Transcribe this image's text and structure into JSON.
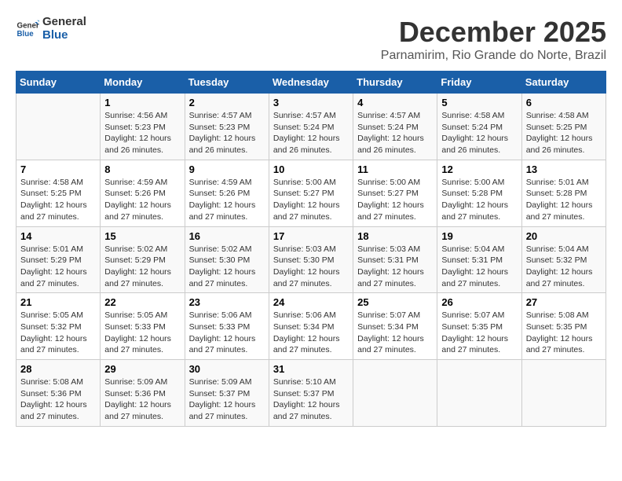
{
  "logo": {
    "line1": "General",
    "line2": "Blue"
  },
  "title": "December 2025",
  "subtitle": "Parnamirim, Rio Grande do Norte, Brazil",
  "days_of_week": [
    "Sunday",
    "Monday",
    "Tuesday",
    "Wednesday",
    "Thursday",
    "Friday",
    "Saturday"
  ],
  "weeks": [
    [
      {
        "day": "",
        "info": ""
      },
      {
        "day": "1",
        "info": "Sunrise: 4:56 AM\nSunset: 5:23 PM\nDaylight: 12 hours\nand 26 minutes."
      },
      {
        "day": "2",
        "info": "Sunrise: 4:57 AM\nSunset: 5:23 PM\nDaylight: 12 hours\nand 26 minutes."
      },
      {
        "day": "3",
        "info": "Sunrise: 4:57 AM\nSunset: 5:24 PM\nDaylight: 12 hours\nand 26 minutes."
      },
      {
        "day": "4",
        "info": "Sunrise: 4:57 AM\nSunset: 5:24 PM\nDaylight: 12 hours\nand 26 minutes."
      },
      {
        "day": "5",
        "info": "Sunrise: 4:58 AM\nSunset: 5:24 PM\nDaylight: 12 hours\nand 26 minutes."
      },
      {
        "day": "6",
        "info": "Sunrise: 4:58 AM\nSunset: 5:25 PM\nDaylight: 12 hours\nand 26 minutes."
      }
    ],
    [
      {
        "day": "7",
        "info": "Sunrise: 4:58 AM\nSunset: 5:25 PM\nDaylight: 12 hours\nand 27 minutes."
      },
      {
        "day": "8",
        "info": "Sunrise: 4:59 AM\nSunset: 5:26 PM\nDaylight: 12 hours\nand 27 minutes."
      },
      {
        "day": "9",
        "info": "Sunrise: 4:59 AM\nSunset: 5:26 PM\nDaylight: 12 hours\nand 27 minutes."
      },
      {
        "day": "10",
        "info": "Sunrise: 5:00 AM\nSunset: 5:27 PM\nDaylight: 12 hours\nand 27 minutes."
      },
      {
        "day": "11",
        "info": "Sunrise: 5:00 AM\nSunset: 5:27 PM\nDaylight: 12 hours\nand 27 minutes."
      },
      {
        "day": "12",
        "info": "Sunrise: 5:00 AM\nSunset: 5:28 PM\nDaylight: 12 hours\nand 27 minutes."
      },
      {
        "day": "13",
        "info": "Sunrise: 5:01 AM\nSunset: 5:28 PM\nDaylight: 12 hours\nand 27 minutes."
      }
    ],
    [
      {
        "day": "14",
        "info": "Sunrise: 5:01 AM\nSunset: 5:29 PM\nDaylight: 12 hours\nand 27 minutes."
      },
      {
        "day": "15",
        "info": "Sunrise: 5:02 AM\nSunset: 5:29 PM\nDaylight: 12 hours\nand 27 minutes."
      },
      {
        "day": "16",
        "info": "Sunrise: 5:02 AM\nSunset: 5:30 PM\nDaylight: 12 hours\nand 27 minutes."
      },
      {
        "day": "17",
        "info": "Sunrise: 5:03 AM\nSunset: 5:30 PM\nDaylight: 12 hours\nand 27 minutes."
      },
      {
        "day": "18",
        "info": "Sunrise: 5:03 AM\nSunset: 5:31 PM\nDaylight: 12 hours\nand 27 minutes."
      },
      {
        "day": "19",
        "info": "Sunrise: 5:04 AM\nSunset: 5:31 PM\nDaylight: 12 hours\nand 27 minutes."
      },
      {
        "day": "20",
        "info": "Sunrise: 5:04 AM\nSunset: 5:32 PM\nDaylight: 12 hours\nand 27 minutes."
      }
    ],
    [
      {
        "day": "21",
        "info": "Sunrise: 5:05 AM\nSunset: 5:32 PM\nDaylight: 12 hours\nand 27 minutes."
      },
      {
        "day": "22",
        "info": "Sunrise: 5:05 AM\nSunset: 5:33 PM\nDaylight: 12 hours\nand 27 minutes."
      },
      {
        "day": "23",
        "info": "Sunrise: 5:06 AM\nSunset: 5:33 PM\nDaylight: 12 hours\nand 27 minutes."
      },
      {
        "day": "24",
        "info": "Sunrise: 5:06 AM\nSunset: 5:34 PM\nDaylight: 12 hours\nand 27 minutes."
      },
      {
        "day": "25",
        "info": "Sunrise: 5:07 AM\nSunset: 5:34 PM\nDaylight: 12 hours\nand 27 minutes."
      },
      {
        "day": "26",
        "info": "Sunrise: 5:07 AM\nSunset: 5:35 PM\nDaylight: 12 hours\nand 27 minutes."
      },
      {
        "day": "27",
        "info": "Sunrise: 5:08 AM\nSunset: 5:35 PM\nDaylight: 12 hours\nand 27 minutes."
      }
    ],
    [
      {
        "day": "28",
        "info": "Sunrise: 5:08 AM\nSunset: 5:36 PM\nDaylight: 12 hours\nand 27 minutes."
      },
      {
        "day": "29",
        "info": "Sunrise: 5:09 AM\nSunset: 5:36 PM\nDaylight: 12 hours\nand 27 minutes."
      },
      {
        "day": "30",
        "info": "Sunrise: 5:09 AM\nSunset: 5:37 PM\nDaylight: 12 hours\nand 27 minutes."
      },
      {
        "day": "31",
        "info": "Sunrise: 5:10 AM\nSunset: 5:37 PM\nDaylight: 12 hours\nand 27 minutes."
      },
      {
        "day": "",
        "info": ""
      },
      {
        "day": "",
        "info": ""
      },
      {
        "day": "",
        "info": ""
      }
    ]
  ]
}
